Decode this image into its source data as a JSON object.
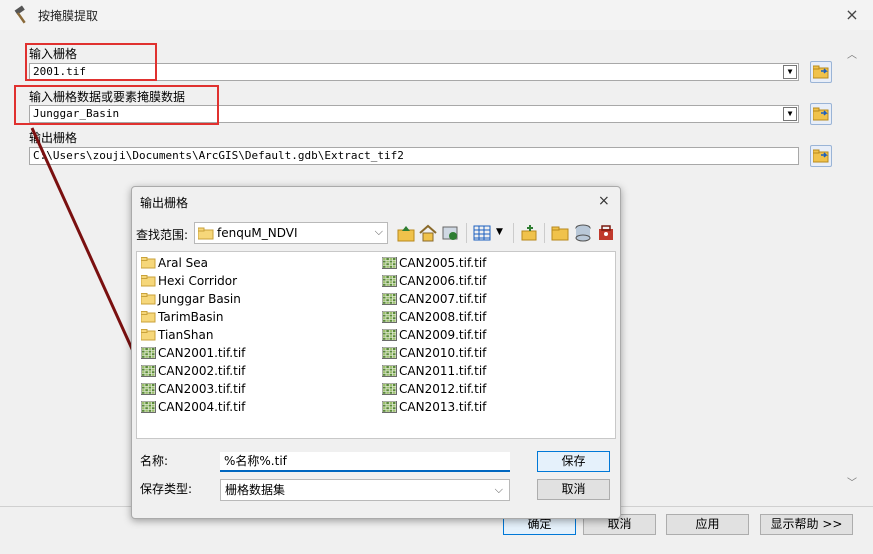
{
  "window": {
    "title": "按掩膜提取",
    "close": "×"
  },
  "fields": {
    "input_raster": {
      "label": "输入栅格",
      "value": "2001.tif"
    },
    "mask": {
      "label": "输入栅格数据或要素掩膜数据",
      "value": "Junggar_Basin"
    },
    "output_raster": {
      "label": "输出栅格",
      "value": "C:\\Users\\zouji\\Documents\\ArcGIS\\Default.gdb\\Extract_tif2"
    }
  },
  "buttons": {
    "ok": "确定",
    "cancel": "取消",
    "apply": "应用",
    "help": "显示帮助 >>"
  },
  "file_dialog": {
    "title": "输出栅格",
    "close": "×",
    "look_in_label": "查找范围:",
    "look_in_value": "fenquM_NDVI",
    "items_left": [
      {
        "name": "Aral Sea",
        "icon": "folder-icon"
      },
      {
        "name": "Hexi Corridor",
        "icon": "folder-icon"
      },
      {
        "name": "Junggar Basin",
        "icon": "folder-icon"
      },
      {
        "name": "TarimBasin",
        "icon": "folder-icon"
      },
      {
        "name": "TianShan",
        "icon": "folder-icon"
      },
      {
        "name": "CAN2001.tif.tif",
        "icon": "raster-icon"
      },
      {
        "name": "CAN2002.tif.tif",
        "icon": "raster-icon"
      },
      {
        "name": "CAN2003.tif.tif",
        "icon": "raster-icon"
      },
      {
        "name": "CAN2004.tif.tif",
        "icon": "raster-icon"
      }
    ],
    "items_right": [
      {
        "name": "CAN2005.tif.tif",
        "icon": "raster-icon"
      },
      {
        "name": "CAN2006.tif.tif",
        "icon": "raster-icon"
      },
      {
        "name": "CAN2007.tif.tif",
        "icon": "raster-icon"
      },
      {
        "name": "CAN2008.tif.tif",
        "icon": "raster-icon"
      },
      {
        "name": "CAN2009.tif.tif",
        "icon": "raster-icon"
      },
      {
        "name": "CAN2010.tif.tif",
        "icon": "raster-icon"
      },
      {
        "name": "CAN2011.tif.tif",
        "icon": "raster-icon"
      },
      {
        "name": "CAN2012.tif.tif",
        "icon": "raster-icon"
      },
      {
        "name": "CAN2013.tif.tif",
        "icon": "raster-icon"
      }
    ],
    "name_label": "名称:",
    "name_value": "%名称%.tif",
    "type_label": "保存类型:",
    "type_value": "栅格数据集",
    "save": "保存",
    "cancel": "取消"
  },
  "colors": {
    "highlight_box": "#e0312f",
    "annotation_arrow": "#7a1010",
    "accent": "#0078d7"
  }
}
